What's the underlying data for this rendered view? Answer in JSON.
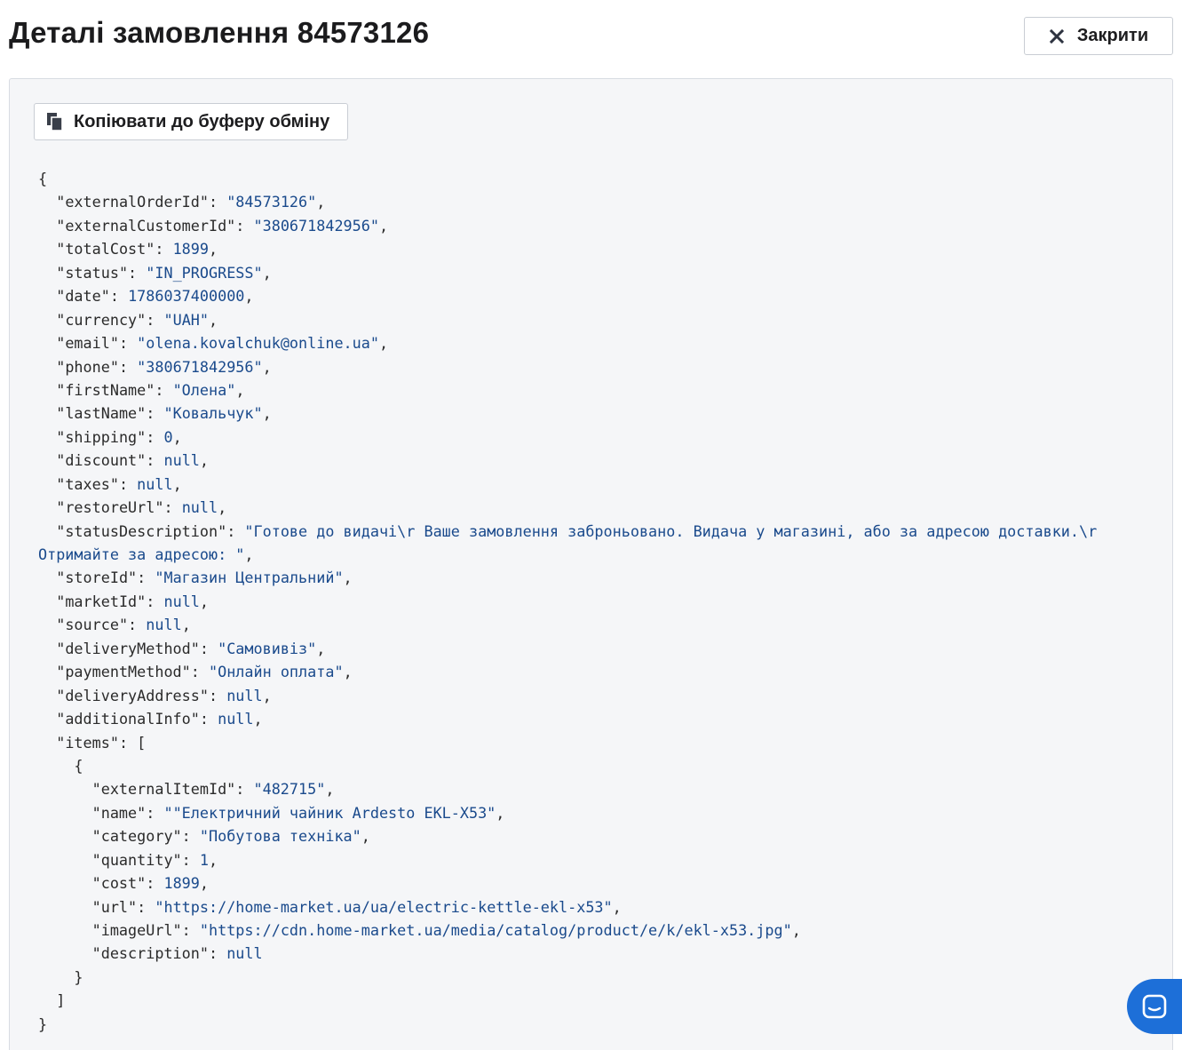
{
  "header": {
    "title": "Деталі замовлення 84573126",
    "close_label": "Закрити"
  },
  "toolbar": {
    "copy_label": "Копіювати до буферу обміну"
  },
  "icons": {
    "close": "close-icon",
    "copy": "copy-icon",
    "chat": "chat-icon"
  },
  "colors": {
    "accent": "#1d6fd8",
    "string_value": "#1a4a8c",
    "panel_bg": "#f5f6f8"
  },
  "json_view": {
    "open_brace": "{",
    "close_brace": "}",
    "fields": [
      {
        "key": "externalOrderId",
        "value": "84573126",
        "type": "string"
      },
      {
        "key": "externalCustomerId",
        "value": "380671842956",
        "type": "string"
      },
      {
        "key": "totalCost",
        "value": "1899",
        "type": "number"
      },
      {
        "key": "status",
        "value": "IN_PROGRESS",
        "type": "string"
      },
      {
        "key": "date",
        "value": "1786037400000",
        "type": "number"
      },
      {
        "key": "currency",
        "value": "UAH",
        "type": "string"
      },
      {
        "key": "email",
        "value": "olena.kovalchuk@online.ua",
        "type": "string"
      },
      {
        "key": "phone",
        "value": "380671842956",
        "type": "string"
      },
      {
        "key": "firstName",
        "value": "Олена",
        "type": "string"
      },
      {
        "key": "lastName",
        "value": "Ковальчук",
        "type": "string"
      },
      {
        "key": "shipping",
        "value": "0",
        "type": "number"
      },
      {
        "key": "discount",
        "value": "null",
        "type": "null"
      },
      {
        "key": "taxes",
        "value": "null",
        "type": "null"
      },
      {
        "key": "restoreUrl",
        "value": "null",
        "type": "null"
      },
      {
        "key": "statusDescription",
        "value_line1": "Готове до видачі\\r Ваше замовлення заброньовано. Видача у магазині, або за адресою доставки.\\r",
        "value_line2": "Отримайте за адресою: ",
        "type": "string-wrapped"
      },
      {
        "key": "storeId",
        "value": "Магазин Центральний",
        "type": "string"
      },
      {
        "key": "marketId",
        "value": "null",
        "type": "null"
      },
      {
        "key": "source",
        "value": "null",
        "type": "null"
      },
      {
        "key": "deliveryMethod",
        "value": "Самовивіз",
        "type": "string"
      },
      {
        "key": "paymentMethod",
        "value": "Онлайн оплата",
        "type": "string"
      },
      {
        "key": "deliveryAddress",
        "value": "null",
        "type": "null"
      },
      {
        "key": "additionalInfo",
        "value": "null",
        "type": "null"
      }
    ],
    "items_key": "items",
    "items_open": "[",
    "items_close": "]",
    "item_open": "{",
    "item_close": "}",
    "item_fields": [
      {
        "key": "externalItemId",
        "value": "482715",
        "type": "string"
      },
      {
        "key": "name",
        "value": "\"Електричний чайник Ardesto EKL-X53",
        "type": "string"
      },
      {
        "key": "category",
        "value": "Побутова техніка",
        "type": "string"
      },
      {
        "key": "quantity",
        "value": "1",
        "type": "number"
      },
      {
        "key": "cost",
        "value": "1899",
        "type": "number"
      },
      {
        "key": "url",
        "value": "https://home-market.ua/ua/electric-kettle-ekl-x53",
        "type": "string"
      },
      {
        "key": "imageUrl",
        "value": "https://cdn.home-market.ua/media/catalog/product/e/k/ekl-x53.jpg",
        "type": "string"
      },
      {
        "key": "description",
        "value": "null",
        "type": "null"
      }
    ]
  }
}
